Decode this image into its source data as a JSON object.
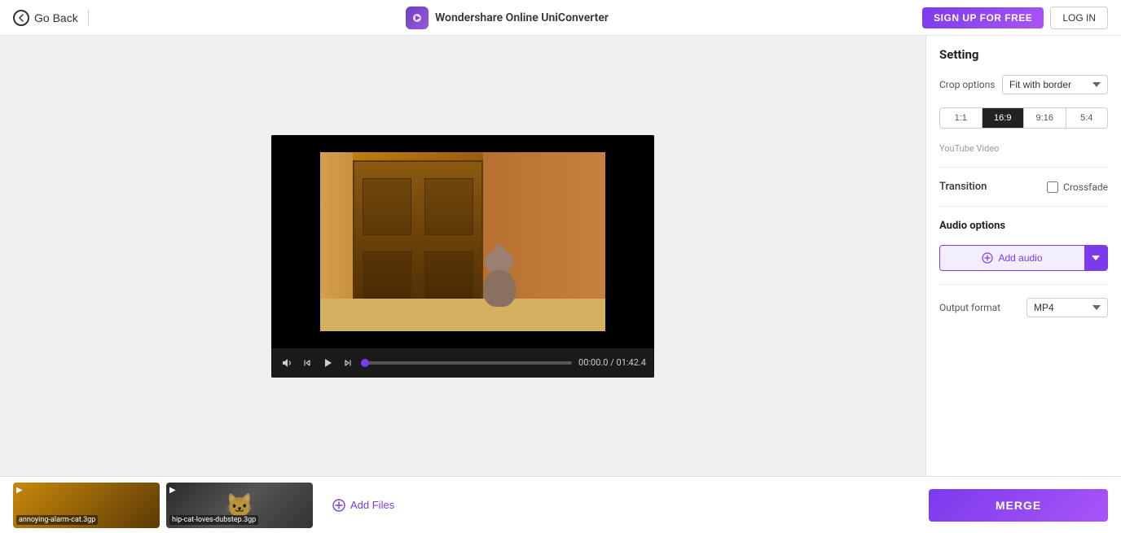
{
  "header": {
    "go_back_label": "Go Back",
    "brand_name": "Wondershare Online UniConverter",
    "sign_up_label": "SIGN UP FOR FREE",
    "log_in_label": "LOG IN"
  },
  "right_panel": {
    "setting_title": "Setting",
    "crop_options_label": "Crop options",
    "crop_options_value": "Fit with border",
    "crop_options_placeholder": "Fit with border",
    "aspect_ratios": [
      {
        "label": "1:1",
        "active": false
      },
      {
        "label": "16:9",
        "active": true
      },
      {
        "label": "9:16",
        "active": false
      },
      {
        "label": "5:4",
        "active": false
      }
    ],
    "aspect_hint": "YouTube Video",
    "transition_label": "Transition",
    "crossfade_label": "Crossfade",
    "audio_title": "Audio options",
    "add_audio_label": "Add audio",
    "output_format_label": "Output format",
    "output_format_value": "MP4"
  },
  "video_controls": {
    "time_current": "00:00.0",
    "time_total": "01:42.4"
  },
  "bottom_strip": {
    "thumbnails": [
      {
        "label": "annoying-alarm-cat.3gp",
        "bg": "1"
      },
      {
        "label": "hip-cat-loves-dubstep.3gp",
        "bg": "2"
      }
    ],
    "add_files_label": "Add Files",
    "merge_label": "MERGE"
  }
}
